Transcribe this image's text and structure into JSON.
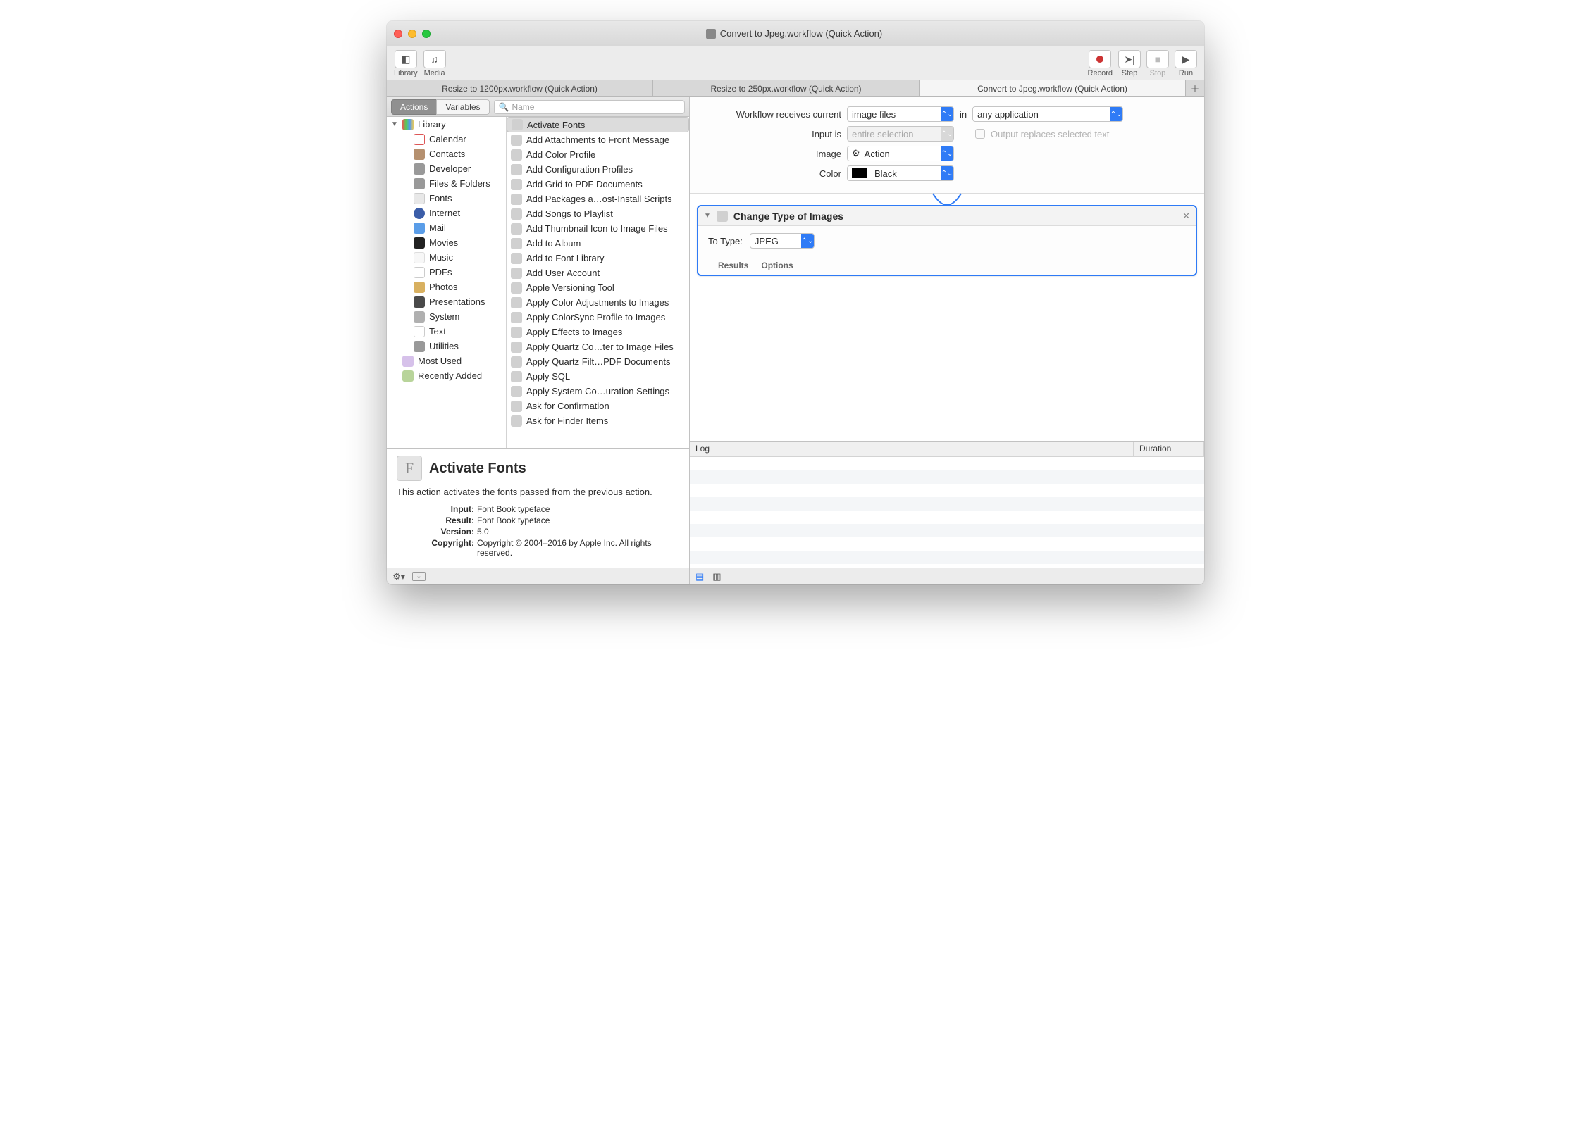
{
  "window": {
    "title": "Convert to Jpeg.workflow (Quick Action)"
  },
  "toolbar": {
    "library": "Library",
    "media": "Media",
    "record": "Record",
    "step": "Step",
    "stop": "Stop",
    "run": "Run"
  },
  "tabs": [
    {
      "label": "Resize to 1200px.workflow (Quick Action)",
      "active": false
    },
    {
      "label": "Resize to 250px.workflow (Quick Action)",
      "active": false
    },
    {
      "label": "Convert to Jpeg.workflow (Quick Action)",
      "active": true
    }
  ],
  "library": {
    "segActions": "Actions",
    "segVariables": "Variables",
    "searchPlaceholder": "Name",
    "root": "Library",
    "most_used": "Most Used",
    "recently_added": "Recently Added",
    "categories": [
      "Calendar",
      "Contacts",
      "Developer",
      "Files & Folders",
      "Fonts",
      "Internet",
      "Mail",
      "Movies",
      "Music",
      "PDFs",
      "Photos",
      "Presentations",
      "System",
      "Text",
      "Utilities"
    ],
    "actions": [
      "Activate Fonts",
      "Add Attachments to Front Message",
      "Add Color Profile",
      "Add Configuration Profiles",
      "Add Grid to PDF Documents",
      "Add Packages a…ost-Install Scripts",
      "Add Songs to Playlist",
      "Add Thumbnail Icon to Image Files",
      "Add to Album",
      "Add to Font Library",
      "Add User Account",
      "Apple Versioning Tool",
      "Apply Color Adjustments to Images",
      "Apply ColorSync Profile to Images",
      "Apply Effects to Images",
      "Apply Quartz Co…ter to Image Files",
      "Apply Quartz Filt…PDF Documents",
      "Apply SQL",
      "Apply System Co…uration Settings",
      "Ask for Confirmation",
      "Ask for Finder Items"
    ],
    "selected_action_index": 0
  },
  "detail": {
    "title": "Activate Fonts",
    "desc": "This action activates the fonts passed from the previous action.",
    "input_k": "Input:",
    "input_v": "Font Book typeface",
    "result_k": "Result:",
    "result_v": "Font Book typeface",
    "version_k": "Version:",
    "version_v": "5.0",
    "copyright_k": "Copyright:",
    "copyright_v": "Copyright © 2004–2016 by Apple Inc. All rights reserved."
  },
  "settings": {
    "receives_label": "Workflow receives current",
    "receives_value": "image files",
    "in_label": "in",
    "in_value": "any application",
    "input_is_label": "Input is",
    "input_is_value": "entire selection",
    "output_replace": "Output replaces selected text",
    "image_label": "Image",
    "image_value": "Action",
    "color_label": "Color",
    "color_value": "Black"
  },
  "action": {
    "title": "Change Type of Images",
    "to_type_label": "To Type:",
    "to_type_value": "JPEG",
    "results": "Results",
    "options": "Options"
  },
  "log": {
    "col1": "Log",
    "col2": "Duration"
  }
}
